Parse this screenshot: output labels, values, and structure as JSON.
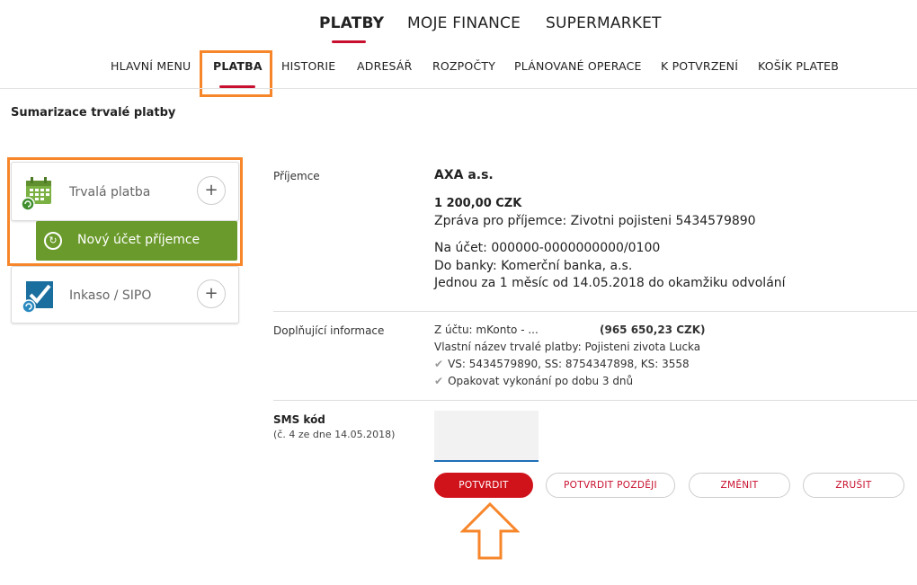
{
  "top_nav": {
    "items": [
      "PLATBY",
      "MOJE FINANCE",
      "SUPERMARKET"
    ]
  },
  "sub_nav": {
    "items": [
      "HLAVNÍ MENU",
      "PLATBA",
      "HISTORIE",
      "ADRESÁŘ",
      "ROZPOČTY",
      "PLÁNOVANÉ OPERACE",
      "K POTVRZENÍ",
      "KOŠÍK PLATEB"
    ]
  },
  "page_title": "Sumarizace trvalé platby",
  "left_panel": {
    "card1_label": "Trvalá platba",
    "card1_action": "+",
    "green_button": "Nový účet příjemce",
    "card2_label": "Inkaso / SIPO",
    "card2_action": "+"
  },
  "recipient": {
    "label": "Příjemce",
    "name": "AXA a.s.",
    "amount": "1 200,00 CZK",
    "message_label": "Zpráva pro příjemce:",
    "message_value": "Zivotni pojisteni 5434579890",
    "account_label": "Na účet:",
    "account_value": "000000-0000000000/0100",
    "bank_label": "Do banky:",
    "bank_value": "Komerční banka, a.s.",
    "frequency": "Jednou za 1 měsíc od 14.05.2018 do okamžiku odvolání"
  },
  "additional": {
    "label": "Doplňující informace",
    "from_label": "Z účtu:",
    "from_value": "mKonto - ...",
    "balance": "(965 650,23 CZK)",
    "name_label": "Vlastní název trvalé platby:",
    "name_value": "Pojisteni zivota Lucka",
    "symbols": "VS: 5434579890, SS: 8754347898, KS: 3558",
    "repeat": "Opakovat vykonání po dobu 3 dnů"
  },
  "sms": {
    "label": "SMS kód",
    "sub_label": "(č. 4 ze dne 14.05.2018)"
  },
  "buttons": {
    "confirm": "POTVRDIT",
    "confirm_later": "POTVRDIT POZDĚJI",
    "change": "ZMĚNIT",
    "cancel": "ZRUŠIT"
  },
  "colors": {
    "brand_red": "#c8102e",
    "highlight_orange": "#f7862b",
    "green": "#6a9a2b"
  }
}
